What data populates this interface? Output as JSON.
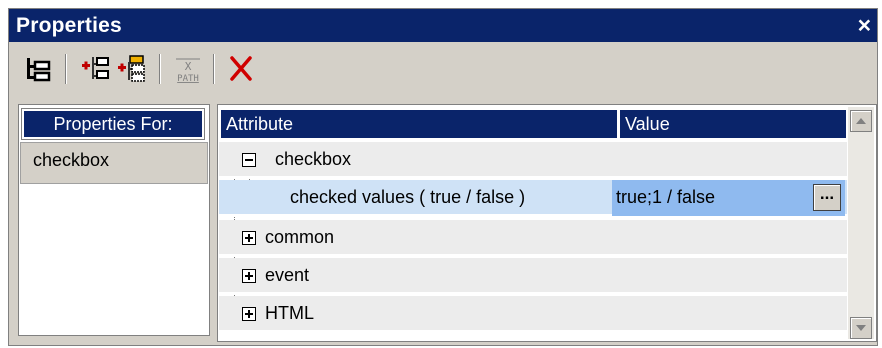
{
  "window": {
    "title": "Properties",
    "close_glyph": "×"
  },
  "toolbar": {
    "buttons": [
      {
        "icon": "tree-view-icon"
      },
      {
        "icon": "add-node-icon"
      },
      {
        "icon": "add-child-node-icon"
      },
      {
        "icon": "xpath-icon",
        "label_top": "X",
        "label_bottom": "PATH"
      },
      {
        "icon": "delete-icon"
      }
    ]
  },
  "left_pane": {
    "header": "Properties For:",
    "items": [
      "checkbox"
    ]
  },
  "right_pane": {
    "columns": [
      "Attribute",
      "Value"
    ],
    "groups": [
      {
        "label": "checkbox",
        "expanded": true,
        "children": [
          {
            "attribute": "checked values ( true / false )",
            "value": "true;1 / false",
            "button": "..."
          }
        ]
      },
      {
        "label": "common",
        "expanded": false
      },
      {
        "label": "event",
        "expanded": false
      },
      {
        "label": "HTML",
        "expanded": false
      }
    ]
  },
  "colors": {
    "title_bar": "#0a246a",
    "selected_row": "#cfe2f6",
    "value_cell": "#8fbaef",
    "delete_red": "#d00000"
  }
}
